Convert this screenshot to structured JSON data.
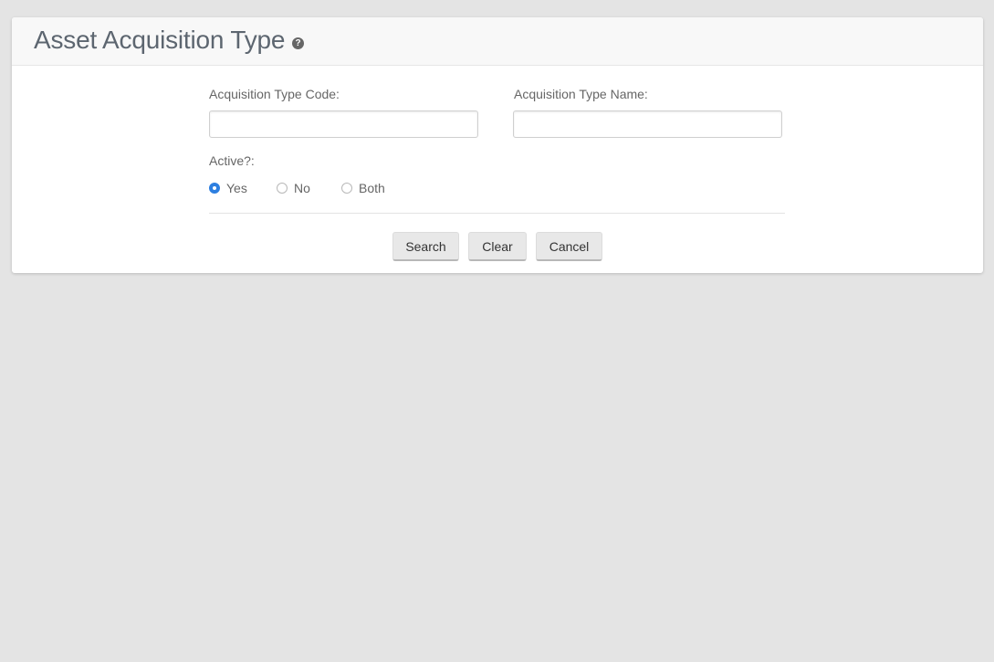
{
  "header": {
    "title": "Asset Acquisition Type",
    "help_icon": "question-circle-icon",
    "help_glyph": "?"
  },
  "form": {
    "code_label": "Acquisition Type Code:",
    "code_value": "",
    "name_label": "Acquisition Type Name:",
    "name_value": "",
    "active_label": "Active?:",
    "active_options": [
      {
        "label": "Yes",
        "checked": true
      },
      {
        "label": "No",
        "checked": false
      },
      {
        "label": "Both",
        "checked": false
      }
    ]
  },
  "buttons": {
    "search": "Search",
    "clear": "Clear",
    "cancel": "Cancel"
  },
  "colors": {
    "accent": "#2d7fe0",
    "background": "#e4e4e4"
  }
}
